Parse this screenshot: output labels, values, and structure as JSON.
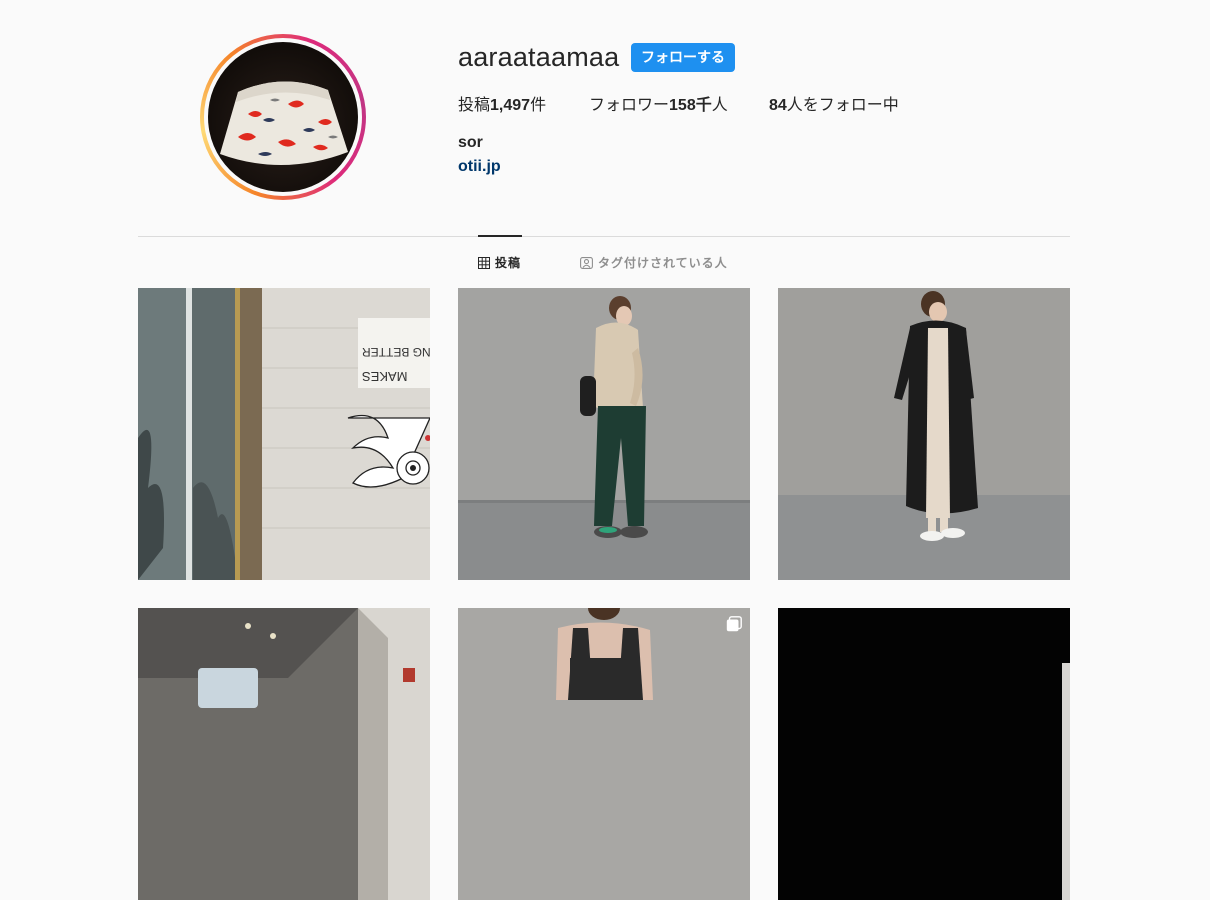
{
  "profile": {
    "username": "aaraataamaa",
    "follow_label": "フォローする",
    "stats": {
      "posts_prefix": "投稿",
      "posts_count": "1,497",
      "posts_suffix": "件",
      "followers_prefix": "フォロワー",
      "followers_count": "158千",
      "followers_suffix": "人",
      "following_count": "84",
      "following_suffix": "人をフォロー中"
    },
    "bio_name": "sor",
    "bio_link": "otii.jp"
  },
  "tabs": {
    "posts_label": "投稿",
    "tagged_label": "タグ付けされている人"
  },
  "posts": [
    {
      "poster_text_1": "ING BETTER",
      "poster_text_2": "MAKES"
    },
    {},
    {},
    {},
    {},
    {}
  ],
  "icons": {
    "posts_tab": "grid-icon",
    "tagged_tab": "tag-user-icon",
    "carousel": "multiple-posts-icon"
  },
  "colors": {
    "accent": "#1e90f0",
    "link": "#00376b",
    "text": "#262626",
    "muted": "#8e8e8e",
    "background": "#fafafa",
    "divider": "#dbdbdb"
  }
}
